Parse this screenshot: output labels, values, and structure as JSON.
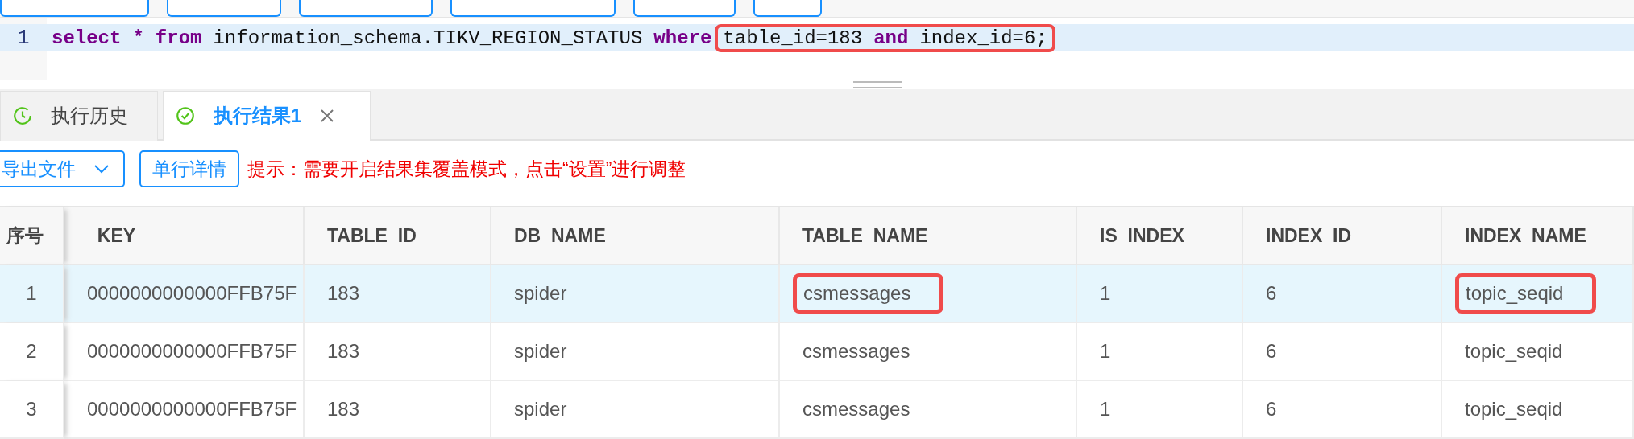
{
  "toolbar": {
    "buttons": [
      {
        "kind": "cut"
      },
      {
        "kind": "cut"
      },
      {
        "kind": "cut"
      },
      {
        "kind": "cut"
      },
      {
        "kind": "cut"
      },
      {
        "kind": "cut"
      }
    ]
  },
  "editor": {
    "line_number": "1",
    "segments": [
      {
        "boxed": false,
        "tokens": [
          {
            "text": "select",
            "kind": "keyword"
          },
          {
            "text": "*",
            "kind": "keyword"
          },
          {
            "text": "from",
            "kind": "keyword"
          },
          {
            "text": "information_schema.TIKV_REGION_STATUS",
            "kind": "plain"
          },
          {
            "text": "where",
            "kind": "keyword"
          }
        ]
      },
      {
        "boxed": true,
        "tokens": [
          {
            "text": "table_id=183",
            "kind": "plain"
          },
          {
            "text": "and",
            "kind": "keyword"
          },
          {
            "text": "index_id=6;",
            "kind": "plain"
          }
        ]
      }
    ]
  },
  "tabs": [
    {
      "label": "执行历史",
      "selected": false,
      "closable": false
    },
    {
      "label": "执行结果1",
      "selected": true,
      "closable": true
    }
  ],
  "actions": {
    "export_button": "导出文件",
    "detail_button": "单行详情",
    "hint": "提示：需要开启结果集覆盖模式，点击“设置”进行调整"
  },
  "table": {
    "columns": [
      "序号",
      "_KEY",
      "TABLE_ID",
      "DB_NAME",
      "TABLE_NAME",
      "IS_INDEX",
      "INDEX_ID",
      "INDEX_NAME"
    ],
    "rows": [
      {
        "selected": true,
        "cells": [
          {
            "text": "1",
            "boxed": false
          },
          {
            "text": "0000000000000FFB75F",
            "boxed": false
          },
          {
            "text": "183",
            "boxed": false
          },
          {
            "text": "spider",
            "boxed": false
          },
          {
            "text": "csmessages",
            "boxed": true
          },
          {
            "text": "1",
            "boxed": false
          },
          {
            "text": "6",
            "boxed": false
          },
          {
            "text": "topic_seqid",
            "boxed": true
          }
        ]
      },
      {
        "selected": false,
        "cells": [
          {
            "text": "2",
            "boxed": false
          },
          {
            "text": "0000000000000FFB75F",
            "boxed": false
          },
          {
            "text": "183",
            "boxed": false
          },
          {
            "text": "spider",
            "boxed": false
          },
          {
            "text": "csmessages",
            "boxed": false
          },
          {
            "text": "1",
            "boxed": false
          },
          {
            "text": "6",
            "boxed": false
          },
          {
            "text": "topic_seqid",
            "boxed": false
          }
        ]
      },
      {
        "selected": false,
        "cells": [
          {
            "text": "3",
            "boxed": false
          },
          {
            "text": "0000000000000FFB75F",
            "boxed": false
          },
          {
            "text": "183",
            "boxed": false
          },
          {
            "text": "spider",
            "boxed": false
          },
          {
            "text": "csmessages",
            "boxed": false
          },
          {
            "text": "1",
            "boxed": false
          },
          {
            "text": "6",
            "boxed": false
          },
          {
            "text": "topic_seqid",
            "boxed": false
          }
        ]
      }
    ]
  }
}
